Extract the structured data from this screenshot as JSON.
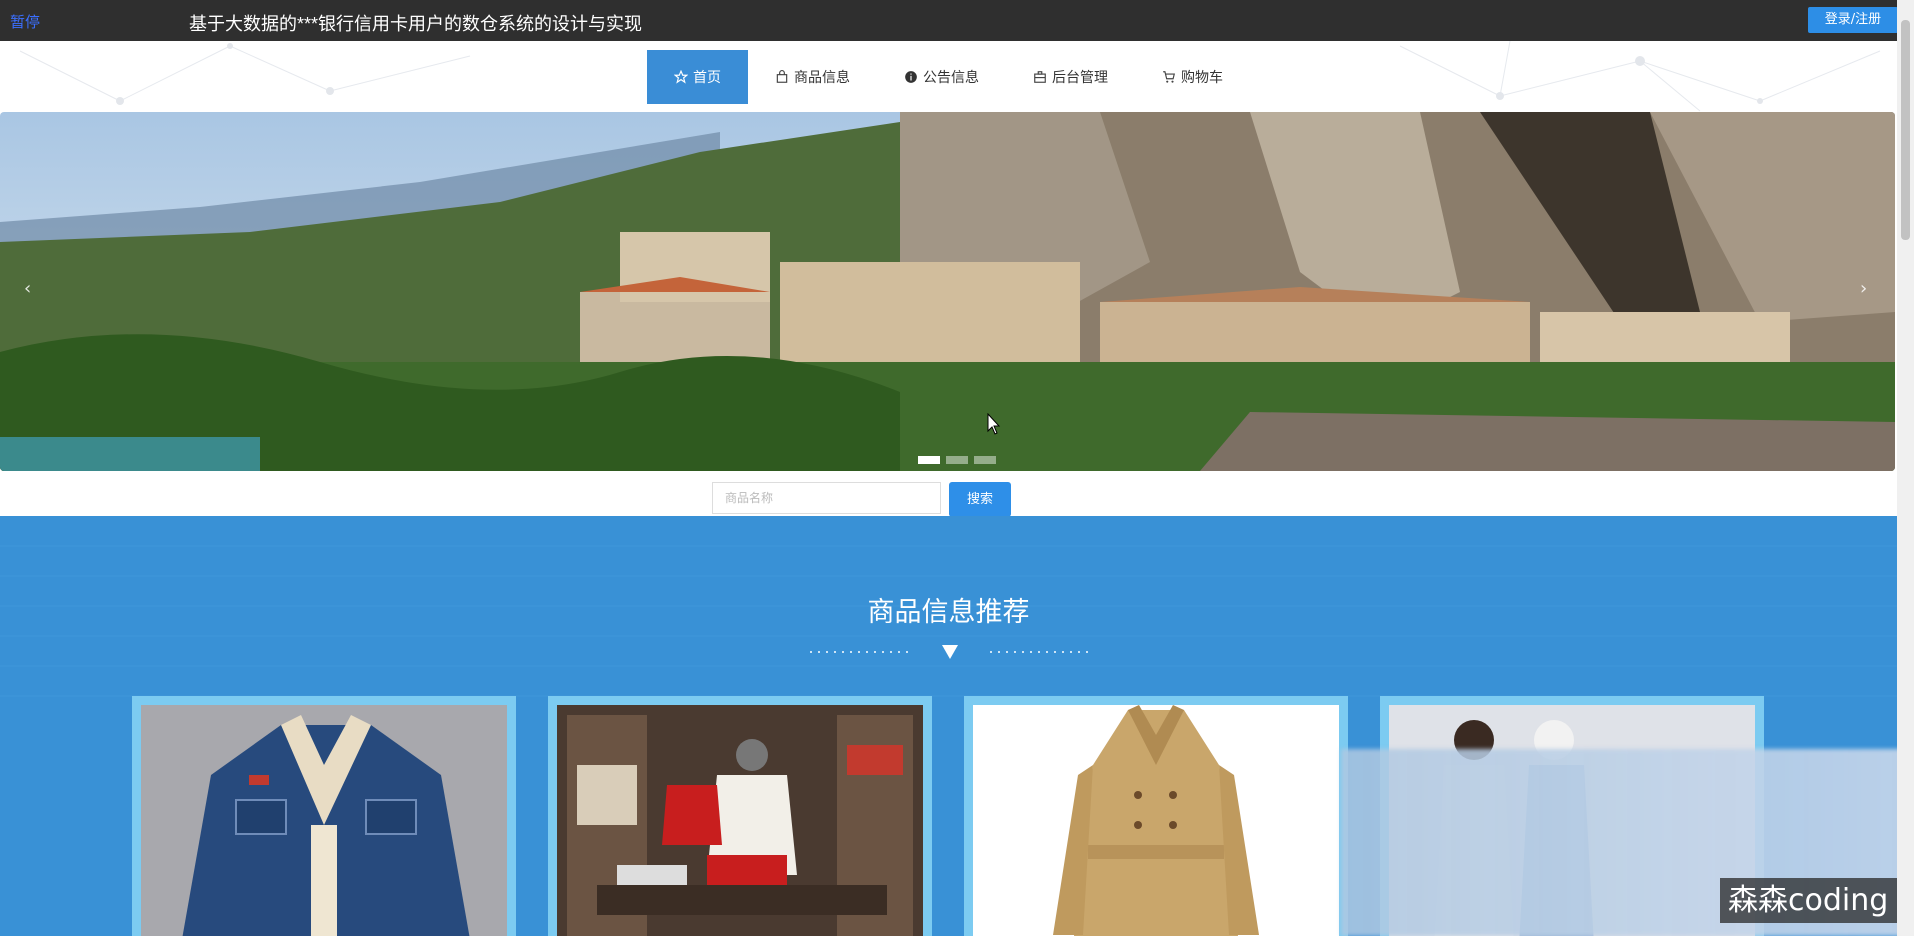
{
  "topbar": {
    "pause_label": "暂停",
    "title": "基于大数据的***银行信用卡用户的数仓系统的设计与实现",
    "login_label": "登录/注册"
  },
  "nav": {
    "items": [
      {
        "label": "首页",
        "icon": "star-icon",
        "active": true
      },
      {
        "label": "商品信息",
        "icon": "bag-icon",
        "active": false
      },
      {
        "label": "公告信息",
        "icon": "info-icon",
        "active": false
      },
      {
        "label": "后台管理",
        "icon": "briefcase-icon",
        "active": false
      },
      {
        "label": "购物车",
        "icon": "cart-icon",
        "active": false
      }
    ]
  },
  "banner": {
    "prev_arrow": "‹",
    "next_arrow": "›",
    "slide_count": 3,
    "active_slide": 1
  },
  "search": {
    "placeholder": "商品名称",
    "value": "",
    "button_label": "搜索"
  },
  "recommend": {
    "title": "商品信息推荐",
    "cards": [
      {
        "image": "denim-sherpa-jacket"
      },
      {
        "image": "clothing-store-display"
      },
      {
        "image": "beige-trench-coat"
      },
      {
        "image": "fashion-models-photo"
      }
    ]
  },
  "watermark": "森森coding",
  "colors": {
    "topbar": "#2f2f2f",
    "accent": "#3a8dd6",
    "section_bg": "#3991d6",
    "card_border": "#7ccbf1"
  }
}
